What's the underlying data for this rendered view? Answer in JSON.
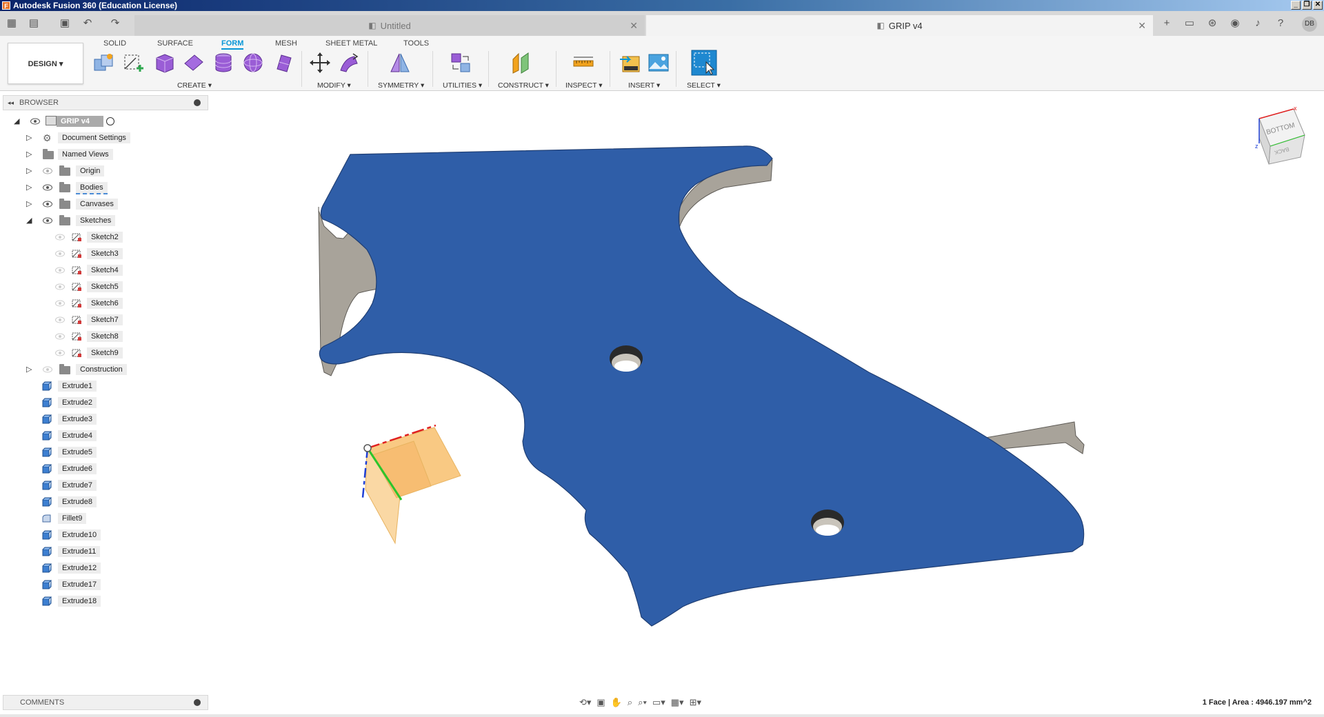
{
  "window": {
    "title": "Autodesk Fusion 360 (Education License)",
    "min": "_",
    "max": "❐",
    "close": "✕"
  },
  "tabs": [
    {
      "label": "Untitled",
      "close": "✕"
    },
    {
      "label": "GRIP v4",
      "close": "✕"
    }
  ],
  "user": {
    "initials": "DB"
  },
  "toolbar": {
    "workspace": "DESIGN ▾",
    "env_tabs": [
      "SOLID",
      "SURFACE",
      "FORM",
      "MESH",
      "SHEET METAL",
      "TOOLS"
    ],
    "groups": {
      "create": "CREATE ▾",
      "modify": "MODIFY ▾",
      "symmetry": "SYMMETRY ▾",
      "utilities": "UTILITIES ▾",
      "construct": "CONSTRUCT ▾",
      "inspect": "INSPECT ▾",
      "insert": "INSERT ▾",
      "select": "SELECT ▾"
    }
  },
  "browser": {
    "title": "BROWSER",
    "root": "GRIP v4",
    "folders": {
      "document_settings": "Document Settings",
      "named_views": "Named Views",
      "origin": "Origin",
      "bodies": "Bodies",
      "canvases": "Canvases",
      "sketches": "Sketches",
      "construction": "Construction"
    },
    "sketches": [
      "Sketch2",
      "Sketch3",
      "Sketch4",
      "Sketch5",
      "Sketch6",
      "Sketch7",
      "Sketch8",
      "Sketch9"
    ],
    "features": [
      "Extrude1",
      "Extrude2",
      "Extrude3",
      "Extrude4",
      "Extrude5",
      "Extrude6",
      "Extrude7",
      "Extrude8",
      "Fillet9",
      "Extrude10",
      "Extrude11",
      "Extrude12",
      "Extrude17",
      "Extrude18"
    ]
  },
  "comments": {
    "title": "COMMENTS"
  },
  "viewcube": {
    "face_top": "BOTTOM",
    "face_side": "BACK"
  },
  "status": {
    "selection": "1 Face | Area : 4946.197 mm^2"
  },
  "colors": {
    "body_face": "#2f5ea8",
    "body_side": "#a8a39a",
    "accent": "#0696d7",
    "origin_plane": "#f7b85a"
  }
}
